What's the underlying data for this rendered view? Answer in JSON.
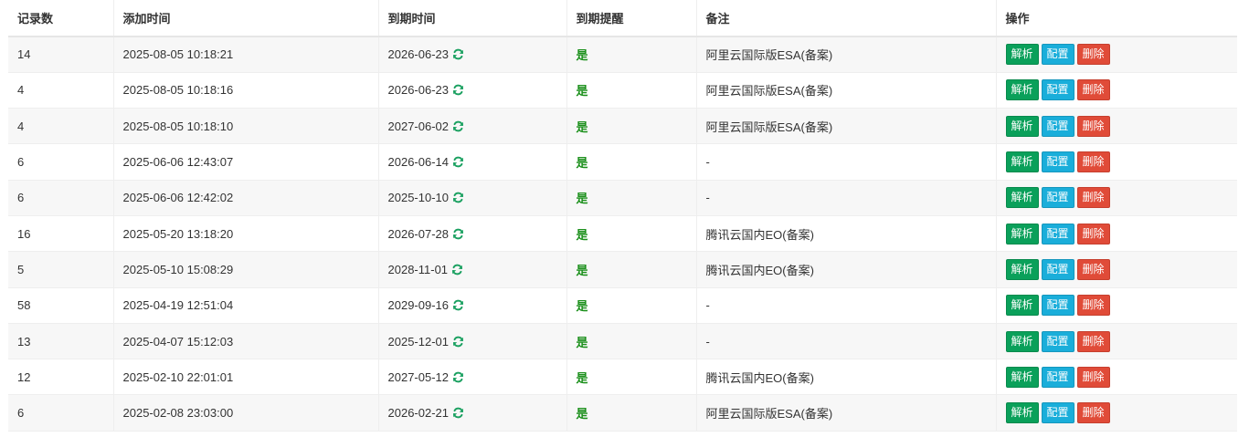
{
  "colors": {
    "remind_green": "#1a8f1a",
    "refresh_icon": "#1aa060",
    "resolve_button": "#0aa05a",
    "config_button": "#1aaeda",
    "delete_button": "#e04b38"
  },
  "table": {
    "headers": {
      "records": "记录数",
      "added": "添加时间",
      "expires": "到期时间",
      "remind": "到期提醒",
      "note": "备注",
      "actions": "操作"
    },
    "buttons": {
      "resolve": "解析",
      "config": "配置",
      "delete": "删除"
    },
    "rows": [
      {
        "records": "14",
        "added": "2025-08-05 10:18:21",
        "expires": "2026-06-23",
        "remind": "是",
        "note": "阿里云国际版ESA(备案)"
      },
      {
        "records": "4",
        "added": "2025-08-05 10:18:16",
        "expires": "2026-06-23",
        "remind": "是",
        "note": "阿里云国际版ESA(备案)"
      },
      {
        "records": "4",
        "added": "2025-08-05 10:18:10",
        "expires": "2027-06-02",
        "remind": "是",
        "note": "阿里云国际版ESA(备案)"
      },
      {
        "records": "6",
        "added": "2025-06-06 12:43:07",
        "expires": "2026-06-14",
        "remind": "是",
        "note": "-"
      },
      {
        "records": "6",
        "added": "2025-06-06 12:42:02",
        "expires": "2025-10-10",
        "remind": "是",
        "note": "-"
      },
      {
        "records": "16",
        "added": "2025-05-20 13:18:20",
        "expires": "2026-07-28",
        "remind": "是",
        "note": "腾讯云国内EO(备案)"
      },
      {
        "records": "5",
        "added": "2025-05-10 15:08:29",
        "expires": "2028-11-01",
        "remind": "是",
        "note": "腾讯云国内EO(备案)"
      },
      {
        "records": "58",
        "added": "2025-04-19 12:51:04",
        "expires": "2029-09-16",
        "remind": "是",
        "note": "-"
      },
      {
        "records": "13",
        "added": "2025-04-07 15:12:03",
        "expires": "2025-12-01",
        "remind": "是",
        "note": "-"
      },
      {
        "records": "12",
        "added": "2025-02-10 22:01:01",
        "expires": "2027-05-12",
        "remind": "是",
        "note": "腾讯云国内EO(备案)"
      },
      {
        "records": "6",
        "added": "2025-02-08 23:03:00",
        "expires": "2026-02-21",
        "remind": "是",
        "note": "阿里云国际版ESA(备案)"
      }
    ]
  }
}
